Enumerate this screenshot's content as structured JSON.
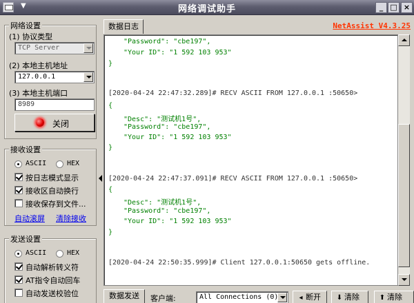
{
  "window": {
    "title": "网络调试助手",
    "brand": "NetAssist V4.3.25"
  },
  "net_settings": {
    "title": "网络设置",
    "protocol_label": "(1) 协议类型",
    "protocol_value": "TCP Server",
    "host_label": "(2) 本地主机地址",
    "host_value": "127.0.0.1",
    "port_label": "(3) 本地主机端口",
    "port_value": "8989",
    "close_label": "关闭"
  },
  "recv_settings": {
    "title": "接收设置",
    "ascii": "ASCII",
    "hex": "HEX",
    "selected_mode": "ASCII",
    "opt_log_mode": "按日志模式显示",
    "opt_auto_wrap": "接收区自动换行",
    "opt_save_file": "接收保存到文件...",
    "link_auto_scroll": "自动滚屏",
    "link_clear": "清除接收"
  },
  "send_settings": {
    "title": "发送设置",
    "ascii": "ASCII",
    "hex": "HEX",
    "selected_mode": "ASCII",
    "opt_parse_escape": "自动解析转义符",
    "opt_at_crlf": "AT指令自动回车",
    "opt_checksum": "自动发送校验位"
  },
  "log": {
    "tab_label": "数据日志",
    "lines": [
      {
        "kind": "kv",
        "text": "\"Password\": \"cbe197\","
      },
      {
        "kind": "kv",
        "text": "\"Your ID\": \"1 592 103 953\""
      },
      {
        "kind": "brace",
        "text": "}"
      },
      {
        "kind": "hdr",
        "text": "[2020-04-24 22:47:32.289]# RECV ASCII FROM 127.0.0.1 :50650>"
      },
      {
        "kind": "brace",
        "text": "{"
      },
      {
        "kind": "kv",
        "text": "\"Desc\": \"测试机1号\","
      },
      {
        "kind": "kv",
        "text": "\"Password\": \"cbe197\","
      },
      {
        "kind": "kv",
        "text": "\"Your ID\": \"1 592 103 953\""
      },
      {
        "kind": "brace",
        "text": "}"
      },
      {
        "kind": "hdr",
        "text": "[2020-04-24 22:47:37.091]# RECV ASCII FROM 127.0.0.1 :50650>"
      },
      {
        "kind": "brace",
        "text": "{"
      },
      {
        "kind": "kv",
        "text": "\"Desc\": \"测试机1号\","
      },
      {
        "kind": "kv",
        "text": "\"Password\": \"cbe197\","
      },
      {
        "kind": "kv",
        "text": "\"Your ID\": \"1 592 103 953\""
      },
      {
        "kind": "brace",
        "text": "}"
      },
      {
        "kind": "hdr",
        "text": "[2020-04-24 22:50:35.999]# Client 127.0.0.1:50650 gets offline."
      }
    ]
  },
  "bottom": {
    "send_tab": "数据发送",
    "client_label": "客户端:",
    "client_value": "All Connections (0)",
    "disconnect": "断开",
    "clear1": "清除",
    "clear2": "清除"
  }
}
